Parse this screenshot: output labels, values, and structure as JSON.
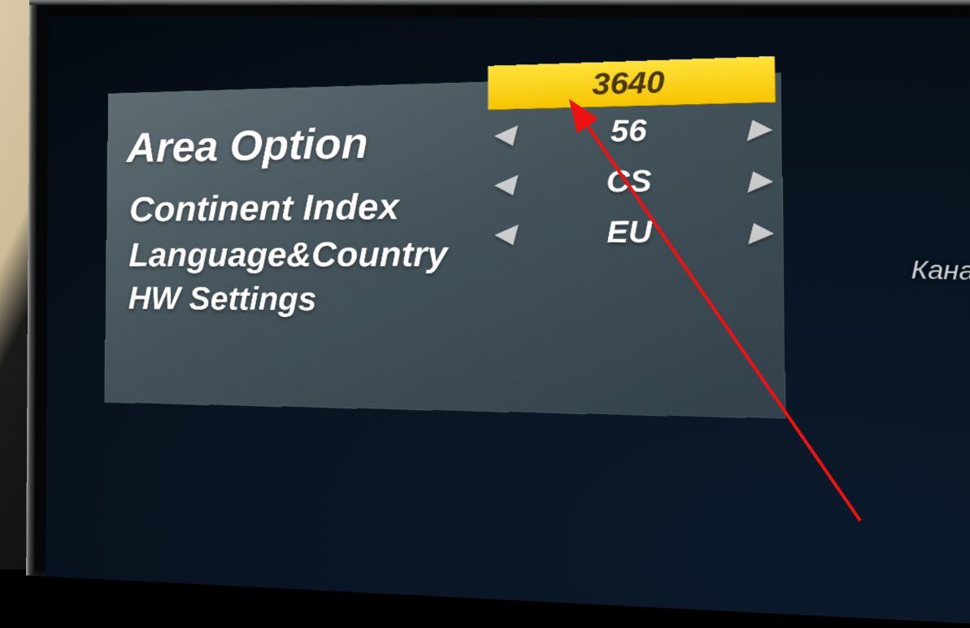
{
  "panel": {
    "title": "Area Option",
    "rows": [
      {
        "label": "Continent Index",
        "value": "56"
      },
      {
        "label": "Language&Country",
        "value": "CS"
      },
      {
        "label": "HW Settings",
        "value": "EU"
      }
    ],
    "selected_value": "3640"
  },
  "ghost_text": "Каналы не",
  "icons": {
    "arrow_left": "◀",
    "arrow_right": "▶"
  }
}
